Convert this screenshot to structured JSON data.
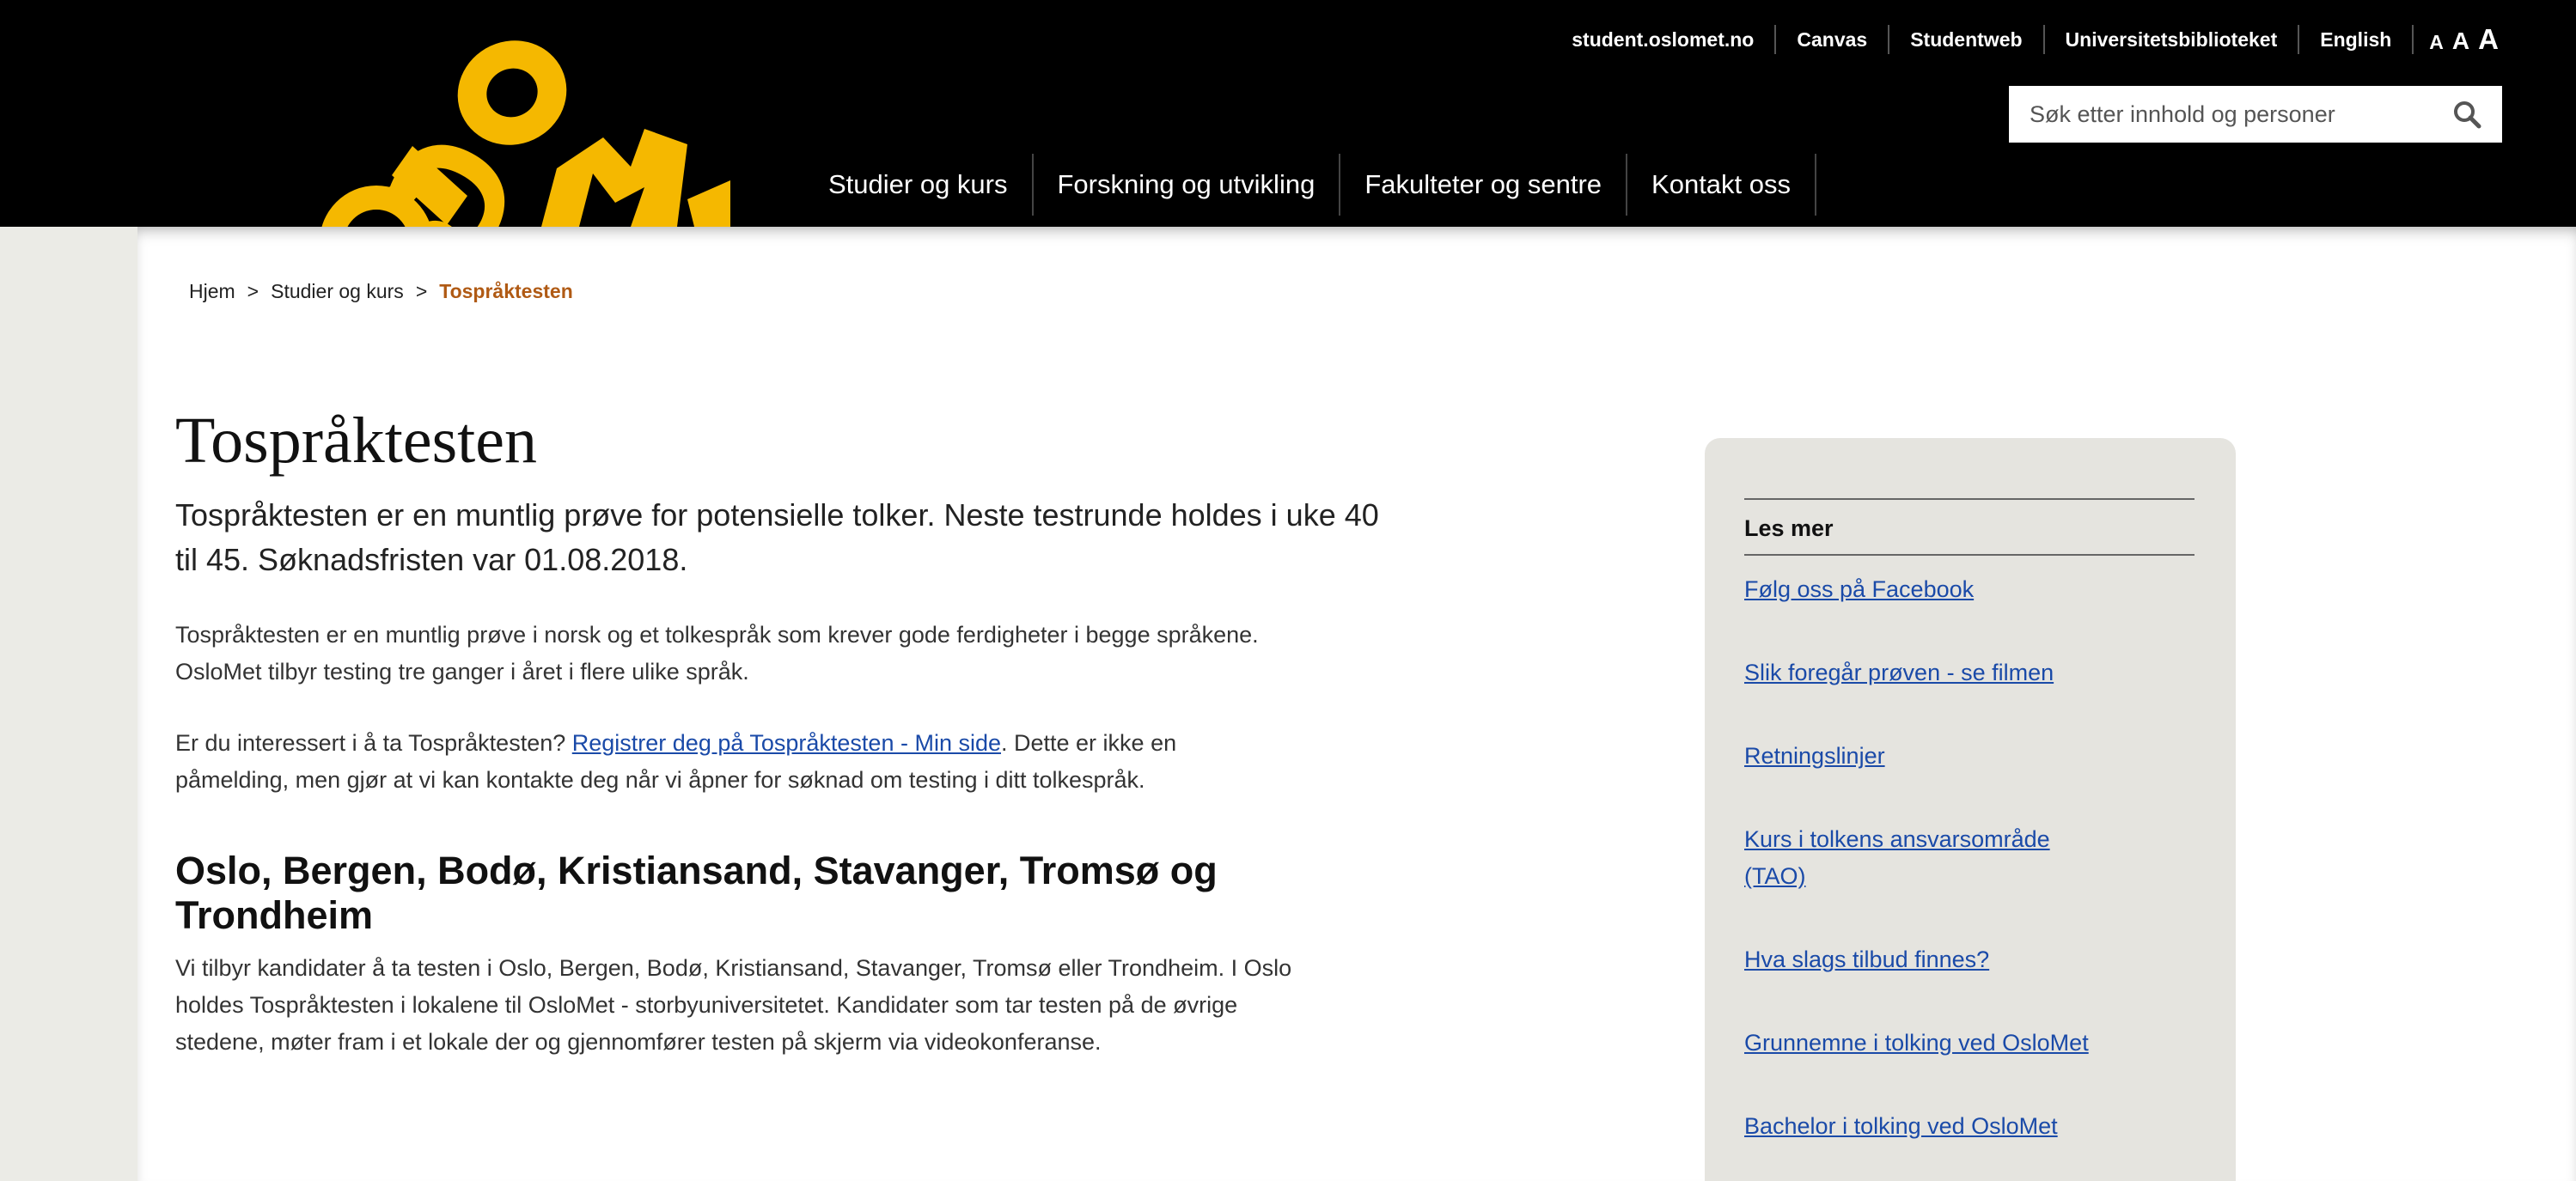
{
  "header": {
    "logo_text": "OSLOMET",
    "top_links": [
      "student.oslomet.no",
      "Canvas",
      "Studentweb",
      "Universitetsbiblioteket",
      "English"
    ],
    "font_sizer": [
      "A",
      "A",
      "A"
    ],
    "search_placeholder": "Søk etter innhold og personer",
    "search_icon": "magnifier-icon",
    "nav": [
      "Studier og kurs",
      "Forskning og utvikling",
      "Fakulteter og sentre",
      "Kontakt oss"
    ],
    "brand_color": "#f5b800"
  },
  "breadcrumb": {
    "home": "Hjem",
    "separator": ">",
    "level1": "Studier og kurs",
    "current": "Tospråktesten"
  },
  "article": {
    "title": "Tospråktesten",
    "lead_line1": "Tospråktesten er en muntlig prøve for potensielle tolker. Neste testrunde holdes i uke 40",
    "lead_line2": "til 45. Søknadsfristen var 01.08.2018.",
    "p1_line1": "Tospråktesten er en muntlig prøve i norsk og et tolkespråk som krever gode ferdigheter i begge språkene.",
    "p1_line2": "OsloMet tilbyr testing tre ganger i året i flere ulike språk.",
    "p2_before": "Er du interessert i å ta Tospråktesten? ",
    "p2_link": "Registrer deg på Tospråktesten - Min side",
    "p2_after": ". Dette er ikke en",
    "p2_line2": "påmelding, men gjør at vi kan kontakte deg når vi åpner for søknad om testing i ditt tolkespråk.",
    "section_heading_line1": "Oslo, Bergen, Bodø, Kristiansand, Stavanger, Tromsø og",
    "section_heading_line2": "Trondheim",
    "p3_line1": "Vi tilbyr kandidater å ta testen i Oslo, Bergen, Bodø, Kristiansand, Stavanger, Tromsø eller Trondheim. I Oslo",
    "p3_line2": "holdes Tospråktesten i lokalene til OsloMet - storbyuniversitetet. Kandidater som tar testen på de øvrige",
    "p3_line3": "stedene, møter fram i et lokale der og gjennomfører testen på skjerm via videokonferanse."
  },
  "sidebar": {
    "title": "Les mer",
    "links": [
      {
        "lines": [
          "Følg oss på Facebook"
        ]
      },
      {
        "lines": [
          "Slik foregår prøven - se filmen"
        ]
      },
      {
        "lines": [
          "Retningslinjer"
        ]
      },
      {
        "lines": [
          "Kurs i tolkens ansvarsområde",
          "(TAO)"
        ]
      },
      {
        "lines": [
          "Hva slags tilbud finnes?"
        ]
      },
      {
        "lines": [
          "Grunnemne i tolking ved OsloMet"
        ]
      },
      {
        "lines": [
          "Bachelor i tolking ved OsloMet"
        ]
      }
    ]
  }
}
